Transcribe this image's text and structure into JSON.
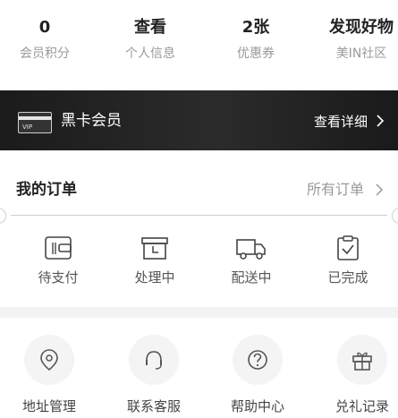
{
  "stats": [
    {
      "value": "0",
      "label": "会员积分"
    },
    {
      "value": "查看",
      "label": "个人信息"
    },
    {
      "value": "2张",
      "label": "优惠券"
    },
    {
      "value": "发现好物",
      "label": "美IN社区"
    }
  ],
  "banner": {
    "card_text": "VIP",
    "title": "黑卡会员",
    "link": "查看详细"
  },
  "orders": {
    "title": "我的订单",
    "all_label": "所有订单",
    "items": [
      {
        "label": "待支付",
        "icon": "wallet-icon"
      },
      {
        "label": "处理中",
        "icon": "package-clock-icon"
      },
      {
        "label": "配送中",
        "icon": "truck-icon"
      },
      {
        "label": "已完成",
        "icon": "clipboard-check-icon"
      }
    ]
  },
  "services": [
    {
      "label": "地址管理",
      "icon": "location-pin-icon"
    },
    {
      "label": "联系客服",
      "icon": "headset-icon"
    },
    {
      "label": "帮助中心",
      "icon": "help-icon"
    },
    {
      "label": "兑礼记录",
      "icon": "gift-box-icon"
    }
  ],
  "colors": {
    "banner_bg": "#222222",
    "muted_text": "#999999",
    "separator": "#f3f3f3"
  }
}
